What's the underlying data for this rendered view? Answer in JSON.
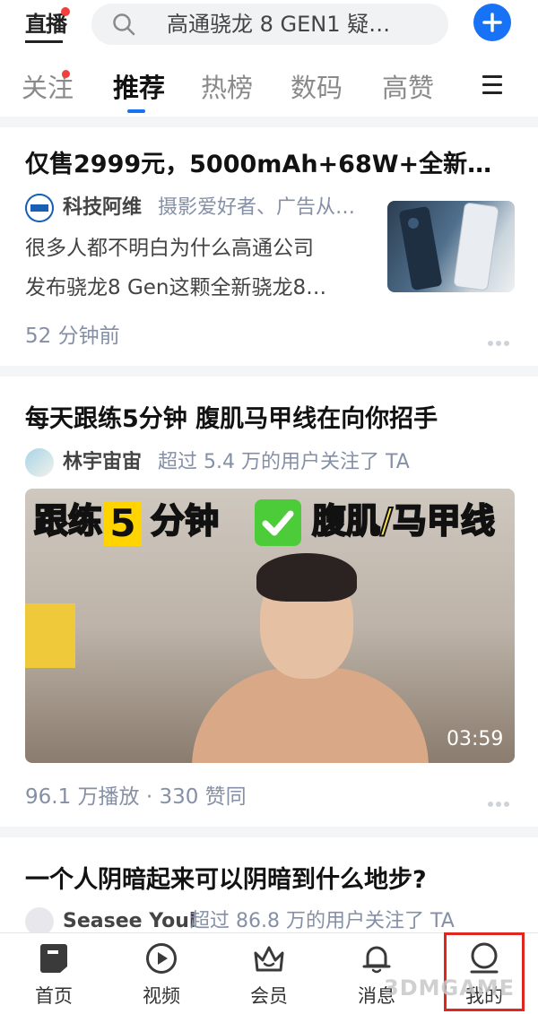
{
  "header": {
    "live_label": "直播",
    "search_text": "高通骁龙 8 GEN1 疑…",
    "tabs": [
      {
        "label": "关注",
        "dot": true
      },
      {
        "label": "推荐",
        "active": true
      },
      {
        "label": "热榜"
      },
      {
        "label": "数码"
      },
      {
        "label": "高赞"
      }
    ]
  },
  "feed": [
    {
      "title": "仅售2999元，5000mAh+68W+全新骁…",
      "author": "科技阿维",
      "author_desc": "摄影爱好者、广告从…",
      "excerpt_line1": "很多人都不明白为什么高通公司",
      "excerpt_line2": "发布骁龙8 Gen这颗全新骁龙8…",
      "meta": "52 分钟前"
    },
    {
      "title": "每天跟练5分钟 腹肌马甲线在向你招手",
      "author": "林宇宙宙",
      "author_desc": "超过 5.4 万的用户关注了 TA",
      "video_banner_1": "跟练",
      "video_banner_num": "5",
      "video_banner_2": "分钟",
      "video_banner_3": "腹肌/马甲线",
      "duration": "03:59",
      "meta": "96.1 万播放 · 330 赞同"
    },
    {
      "title": "一个人阴暗起来可以阴暗到什么地步?",
      "author": "Seasee Youl",
      "author_desc": "超过 86.8 万的用户关注了 TA"
    }
  ],
  "bottom_nav": [
    {
      "label": "首页",
      "icon": "home-icon"
    },
    {
      "label": "视频",
      "icon": "video-play-icon"
    },
    {
      "label": "会员",
      "icon": "crown-icon"
    },
    {
      "label": "消息",
      "icon": "bell-icon"
    },
    {
      "label": "我的",
      "icon": "profile-icon"
    }
  ],
  "watermark": "3DMGAME",
  "colors": {
    "accent": "#1772f6",
    "badge": "#f1403c",
    "highlight": "#e0261f"
  }
}
